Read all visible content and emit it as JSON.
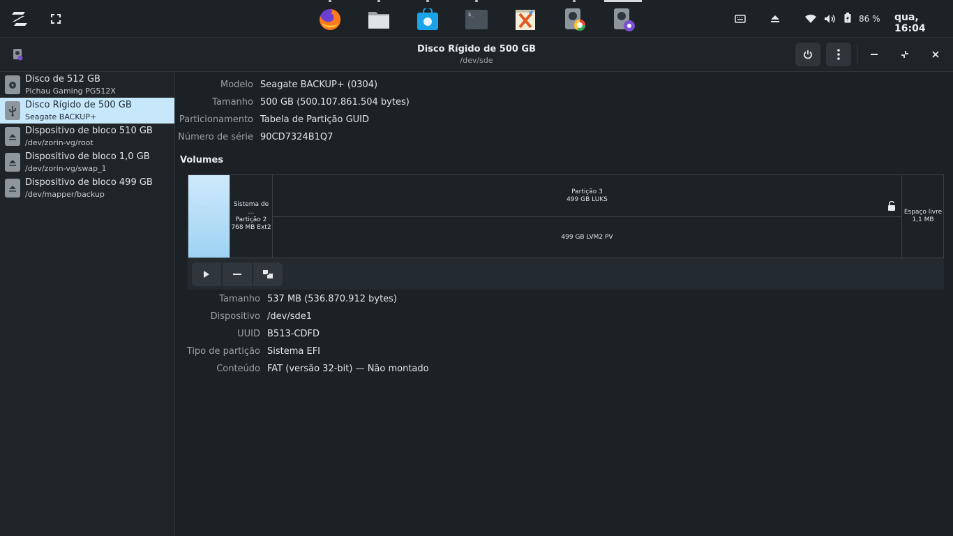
{
  "panel": {
    "battery_percent": "86 %",
    "clock": "qua, 16:04"
  },
  "header": {
    "title": "Disco Rígido de 500 GB",
    "subtitle": "/dev/sde"
  },
  "sidebar": {
    "items": [
      {
        "name": "Disco de 512 GB",
        "sub": "Pichau Gaming PG512X",
        "icon": "ssd-icon"
      },
      {
        "name": "Disco Rígido de 500 GB",
        "sub": "Seagate BACKUP+",
        "icon": "usb-drive-icon"
      },
      {
        "name": "Dispositivo de bloco 510 GB",
        "sub": "/dev/zorin-vg/root",
        "icon": "block-device-icon"
      },
      {
        "name": "Dispositivo de bloco 1,0 GB",
        "sub": "/dev/zorin-vg/swap_1",
        "icon": "block-device-icon"
      },
      {
        "name": "Dispositivo de bloco 499 GB",
        "sub": "/dev/mapper/backup",
        "icon": "block-device-icon"
      }
    ]
  },
  "drive_info": {
    "model_label": "Modelo",
    "model_value": "Seagate BACKUP+ (0304)",
    "size_label": "Tamanho",
    "size_value": "500 GB (500.107.861.504 bytes)",
    "partitioning_label": "Particionamento",
    "partitioning_value": "Tabela de Partição GUID",
    "serial_label": "Número de série",
    "serial_value": "90CD7324B1Q7"
  },
  "volumes": {
    "title": "Volumes",
    "p1": {
      "line1": "Sistema de",
      "line2": "Partição 1",
      "line3": "537 MB FAT"
    },
    "p2": {
      "line1": "Sistema de …",
      "line2": "Partição 2",
      "line3": "768 MB Ext2"
    },
    "p3": {
      "line1": "Partição 3",
      "line2": "499 GB LUKS"
    },
    "lvm": {
      "line1": "499 GB LVM2 PV"
    },
    "free": {
      "line1": "Espaço livre",
      "line2": "1,1 MB"
    }
  },
  "partition_info": {
    "size_label": "Tamanho",
    "size_value": "537 MB (536.870.912 bytes)",
    "device_label": "Dispositivo",
    "device_value": "/dev/sde1",
    "uuid_label": "UUID",
    "uuid_value": "B513-CDFD",
    "type_label": "Tipo de partição",
    "type_value": "Sistema EFI",
    "content_label": "Conteúdo",
    "content_value": "FAT (versão 32-bit) — Não montado"
  },
  "colors": {
    "accent_selected": "#c7e7fa",
    "background": "#1c2126"
  }
}
